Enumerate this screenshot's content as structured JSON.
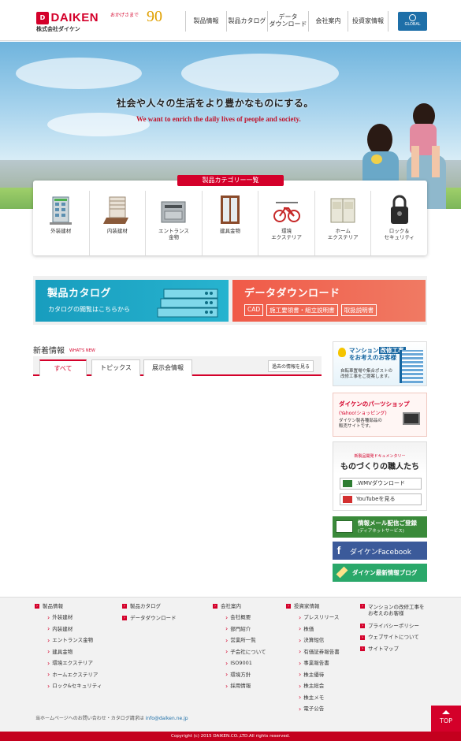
{
  "header": {
    "logo_text": "DAIKEN",
    "company_name": "株式会社ダイケン",
    "anniversary_text": "おかげさまで",
    "anniversary_number": "90",
    "nav": [
      {
        "label": "製品情報"
      },
      {
        "label": "製品カタログ"
      },
      {
        "label": "データ\nダウンロード"
      },
      {
        "label": "会社案内"
      },
      {
        "label": "投資家情報"
      }
    ],
    "global_label": "GLOBAL"
  },
  "hero": {
    "headline": "社会や人々の生活をより豊かなものにする。",
    "subline": "We want to enrich the daily lives of people and society."
  },
  "categories": {
    "title": "製品カテゴリー一覧",
    "items": [
      {
        "label": "外装建材",
        "icon": "building-icon"
      },
      {
        "label": "内装建材",
        "icon": "interior-icon"
      },
      {
        "label": "エントランス\n金物",
        "icon": "mailbox-icon"
      },
      {
        "label": "建具金物",
        "icon": "door-icon"
      },
      {
        "label": "環境\nエクステリア",
        "icon": "bicycle-rack-icon"
      },
      {
        "label": "ホーム\nエクステリア",
        "icon": "storage-shed-icon"
      },
      {
        "label": "ロック＆\nセキュリティ",
        "icon": "lock-icon"
      }
    ]
  },
  "banners": {
    "catalog_title": "製品カタログ",
    "catalog_sub": "カタログの閲覧はこちらから",
    "download_title": "データダウンロード",
    "download_tags": [
      "CAD",
      "施工要領書・組立説明書",
      "取扱説明書"
    ]
  },
  "news": {
    "title": "新着情報",
    "title_en": "WHAT'S NEW",
    "tabs": [
      "すべて",
      "トピックス",
      "展示会情報"
    ],
    "past_link": "過去の情報を見る"
  },
  "sidebar": {
    "mansion_title_1": "マンション",
    "mansion_title_em": "改修工事",
    "mansion_title_2": "をお考えのお客様",
    "mansion_desc": "自転車置場や集合ポストの\n改修工事をご提案します。",
    "parts_title": "ダイケンのパーツショップ",
    "parts_sub": "(Yahoo!ショッピング)",
    "parts_desc": "ダイケン製各種部品の\n販売サイトです。",
    "doc_label": "新製品開発ドキュメンタリー",
    "doc_title": "ものづくりの職人たち",
    "wmv_label": ".WMVダウンロード",
    "youtube_label": "YouTubeを見る",
    "mail_title": "情報メール配信ご登録",
    "mail_sub": "(ディアネットサービス)",
    "fb_label": "ダイケンFacebook",
    "blog_label": "ダイケン最新情報ブログ"
  },
  "footer": {
    "col1": {
      "title": "製品情報",
      "items": [
        "外装建材",
        "内装建材",
        "エントランス金物",
        "建具金物",
        "環境エクステリア",
        "ホームエクステリア",
        "ロック&セキュリティ"
      ]
    },
    "col2": {
      "title": "製品カタログ",
      "items": [],
      "title2": "データダウンロード"
    },
    "col3": {
      "title": "会社案内",
      "items": [
        "会社概要",
        "部門紹介",
        "営業所一覧",
        "子会社について",
        "ISO9001",
        "環境方針",
        "採用情報"
      ]
    },
    "col4": {
      "title": "投資家情報",
      "items": [
        "プレスリリース",
        "株価",
        "決算短信",
        "有価証券報告書",
        "事業報告書",
        "株主優待",
        "株主総会",
        "株主メモ",
        "電子公告"
      ]
    },
    "col5": {
      "title": "マンションの改修工事を\nお考えのお客様",
      "links": [
        "プライバシーポリシー",
        "ウェブサイトについて",
        "サイトマップ"
      ]
    },
    "contact": "当ホームページへのお問い合わせ・カタログ請求は",
    "contact_email": "info@daiken.ne.jp",
    "copyright": "Copyright (c) 2015 DAIKEN.CO.,LTD.All rights reserved.",
    "top_label": "TOP"
  },
  "colors": {
    "brand_red": "#d4002a",
    "blue": "#1e6fa8",
    "catalog_teal": "#189dbe",
    "download_coral": "#f05a48"
  }
}
